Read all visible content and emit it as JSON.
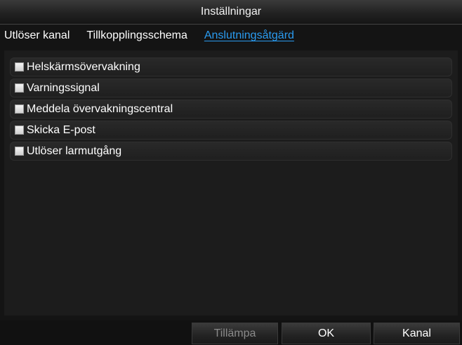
{
  "window": {
    "title": "Inställningar"
  },
  "tabs": [
    {
      "label": "Utlöser kanal"
    },
    {
      "label": "Tillkopplingsschema"
    },
    {
      "label": "Anslutningsåtgärd",
      "active": true
    }
  ],
  "options": [
    {
      "label": "Helskärmsövervakning",
      "checked": false
    },
    {
      "label": "Varningssignal",
      "checked": false
    },
    {
      "label": "Meddela övervakningscentral",
      "checked": false
    },
    {
      "label": "Skicka E-post",
      "checked": false
    },
    {
      "label": "Utlöser larmutgång",
      "checked": false
    }
  ],
  "buttons": {
    "apply_label": "Tillämpa",
    "apply_enabled": false,
    "ok_label": "OK",
    "channel_label": "Kanal"
  },
  "colors": {
    "active_tab": "#2a9bf0",
    "background": "#141414"
  }
}
